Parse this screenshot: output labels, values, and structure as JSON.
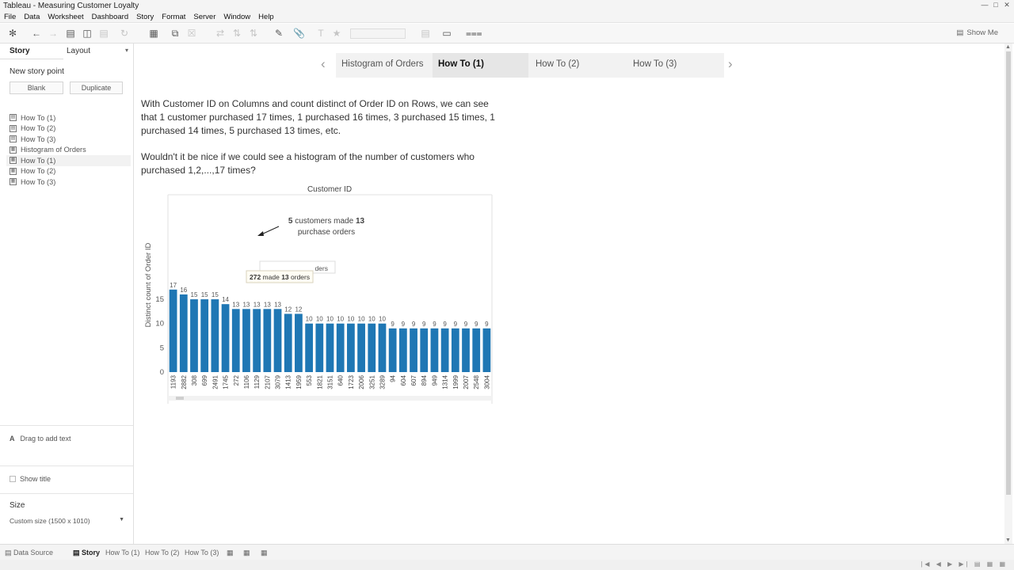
{
  "window": {
    "title": "Tableau - Measuring Customer Loyalty"
  },
  "menu": [
    "File",
    "Data",
    "Worksheet",
    "Dashboard",
    "Story",
    "Format",
    "Server",
    "Window",
    "Help"
  ],
  "toolbar": {
    "show_me": "Show Me"
  },
  "left_pane": {
    "tabs": {
      "story": "Story",
      "layout": "Layout"
    },
    "new_story_point": "New story point",
    "blank_button": "Blank",
    "duplicate_button": "Duplicate",
    "sheets": [
      {
        "label": "How To (1)"
      },
      {
        "label": "How To (2)"
      },
      {
        "label": "How To (3)"
      },
      {
        "label": "Histogram of Orders"
      },
      {
        "label": "How To (1)"
      },
      {
        "label": "How To (2)"
      },
      {
        "label": "How To (3)"
      }
    ],
    "drag_text": "Drag to add text",
    "show_title": "Show title",
    "size_label": "Size",
    "size_value": "Custom size (1500 x 1010)"
  },
  "story": {
    "points": [
      "Histogram of Orders",
      "How To (1)",
      "How To (2)",
      "How To (3)"
    ],
    "active_index": 1
  },
  "text": {
    "para1": "With Customer ID on Columns and count distinct of Order ID on Rows, we can see that 1 customer purchased 17 times, 1 purchased 16 times, 3 purchased 15 times, 1 purchased 14 times, 5 purchased 13 times, etc.",
    "para2": "Wouldn't it be nice if we could see a histogram of the number of customers who purchased 1,2,...,17 times?"
  },
  "chart_data": {
    "type": "bar",
    "title": "Customer ID",
    "ylabel": "Distinct count of Order ID",
    "ylim": [
      0,
      17
    ],
    "yticks": [
      0,
      5,
      10,
      15
    ],
    "categories": [
      "1193",
      "2882",
      "308",
      "699",
      "2491",
      "1745",
      "272",
      "1106",
      "1129",
      "2107",
      "3079",
      "1413",
      "1959",
      "553",
      "1821",
      "3151",
      "640",
      "1723",
      "2006",
      "3251",
      "3289",
      "94",
      "604",
      "607",
      "894",
      "949",
      "1314",
      "1999",
      "2007",
      "2548",
      "3004"
    ],
    "values": [
      17,
      16,
      15,
      15,
      15,
      14,
      13,
      13,
      13,
      13,
      13,
      12,
      12,
      10,
      10,
      10,
      10,
      10,
      10,
      10,
      10,
      9,
      9,
      9,
      9,
      9,
      9,
      9,
      9,
      9,
      9
    ],
    "bar_color": "#1f77b4",
    "annotation": {
      "prefix": "5",
      "mid": " customers made ",
      "bold": "13",
      "line2": "purchase orders"
    },
    "tooltip": {
      "bold1": "272",
      "mid": " made ",
      "bold2": "13",
      "suffix": " orders"
    },
    "ghost_tooltip_text": "ders"
  },
  "bottom_tabs": {
    "data_source": "Data Source",
    "story": "Story",
    "t1": "How To (1)",
    "t2": "How To (2)",
    "t3": "How To (3)"
  }
}
